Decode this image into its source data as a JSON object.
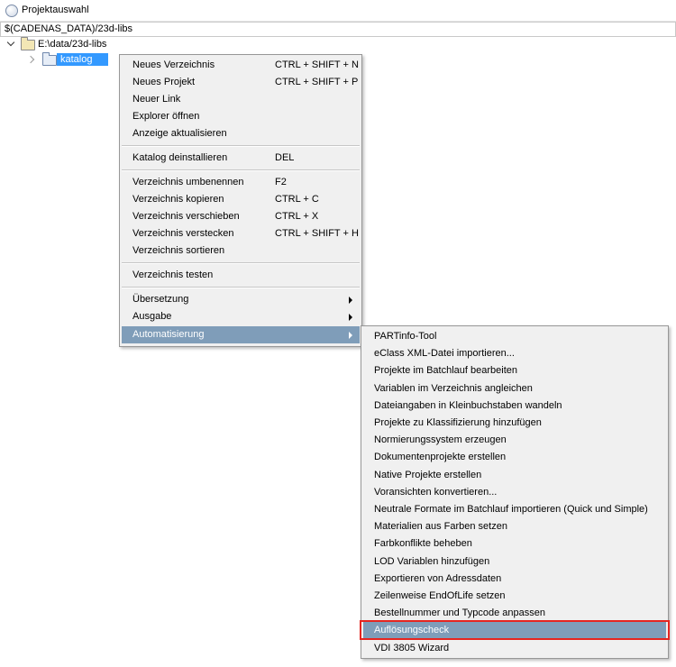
{
  "window": {
    "title": "Projektauswahl"
  },
  "path_bar": {
    "path": "$(CADENAS_DATA)/23d-libs"
  },
  "tree": {
    "root": {
      "label": "E:\\data/23d-libs"
    },
    "selected": {
      "label": "katalog"
    }
  },
  "context_menu": {
    "items": [
      {
        "label": "Neues Verzeichnis",
        "shortcut": "CTRL + SHIFT + N"
      },
      {
        "label": "Neues Projekt",
        "shortcut": "CTRL + SHIFT + P"
      },
      {
        "label": "Neuer Link",
        "shortcut": ""
      },
      {
        "label": "Explorer öffnen",
        "shortcut": ""
      },
      {
        "label": "Anzeige aktualisieren",
        "shortcut": ""
      },
      {
        "label": "Katalog deinstallieren",
        "shortcut": "DEL"
      },
      {
        "label": "Verzeichnis umbenennen",
        "shortcut": "F2"
      },
      {
        "label": "Verzeichnis kopieren",
        "shortcut": "CTRL + C"
      },
      {
        "label": "Verzeichnis verschieben",
        "shortcut": "CTRL + X"
      },
      {
        "label": "Verzeichnis verstecken",
        "shortcut": "CTRL + SHIFT + H"
      },
      {
        "label": "Verzeichnis sortieren",
        "shortcut": ""
      },
      {
        "label": "Verzeichnis testen",
        "shortcut": ""
      },
      {
        "label": "Übersetzung",
        "shortcut": ""
      },
      {
        "label": "Ausgabe",
        "shortcut": ""
      },
      {
        "label": "Automatisierung",
        "shortcut": ""
      }
    ]
  },
  "automation_submenu": {
    "items": [
      "PARTinfo-Tool",
      "eClass XML-Datei importieren...",
      "Projekte im Batchlauf bearbeiten",
      "Variablen im Verzeichnis angleichen",
      "Dateiangaben in Kleinbuchstaben wandeln",
      "Projekte zu Klassifizierung hinzufügen",
      "Normierungssystem erzeugen",
      "Dokumentenprojekte erstellen",
      "Native Projekte erstellen",
      "Voransichten konvertieren...",
      "Neutrale Formate im Batchlauf importieren (Quick und Simple)",
      "Materialien aus Farben setzen",
      "Farbkonflikte beheben",
      "LOD Variablen hinzufügen",
      "Exportieren von Adressdaten",
      "Zeilenweise EndOfLife setzen",
      "Bestellnummer und Typcode anpassen",
      "Auflösungscheck",
      "VDI 3805 Wizard"
    ]
  },
  "colors": {
    "highlight": "#7f9db9",
    "selection": "#3399ff",
    "callout": "#e52520"
  }
}
